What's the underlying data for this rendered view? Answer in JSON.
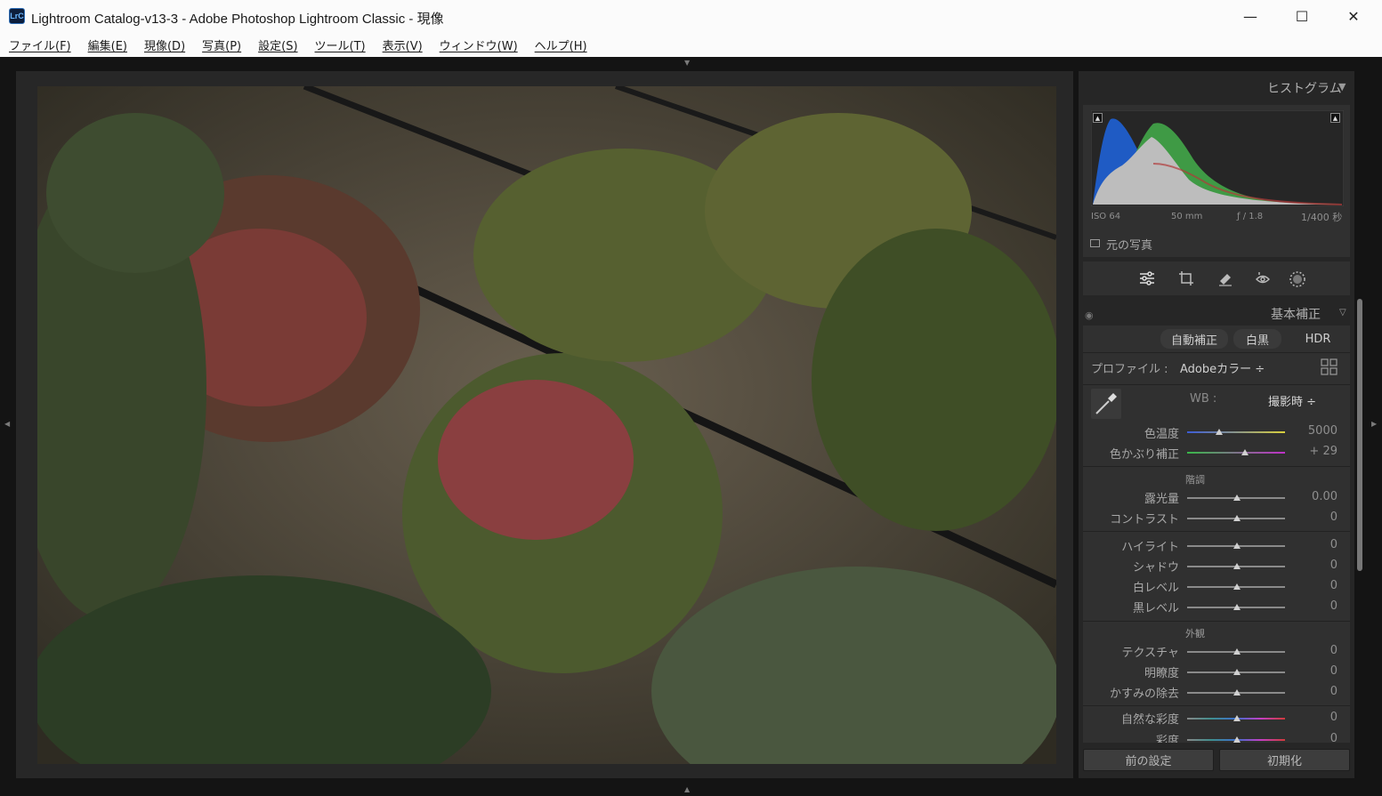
{
  "window": {
    "app_icon_text": "LrC",
    "title": "Lightroom Catalog-v13-3 - Adobe Photoshop Lightroom Classic - 現像",
    "minimize": "—",
    "maximize": "☐",
    "close": "✕"
  },
  "menu": [
    "ファイル(F)",
    "編集(E)",
    "現像(D)",
    "写真(P)",
    "設定(S)",
    "ツール(T)",
    "表示(V)",
    "ウィンドウ(W)",
    "ヘルプ(H)"
  ],
  "histogram": {
    "title": "ヒストグラム",
    "iso": "ISO 64",
    "focal": "50 mm",
    "aperture": "ƒ / 1.8",
    "shutter": "1/400 秒",
    "original_photo": "元の写真"
  },
  "tools": [
    "sliders",
    "crop",
    "eraser",
    "redeye",
    "mask"
  ],
  "basic": {
    "title": "基本補正",
    "auto": "自動補正",
    "bw": "白黒",
    "hdr": "HDR",
    "profile_label": "プロファイル :",
    "profile_value": "Adobeカラー ÷",
    "wb_label": "WB :",
    "wb_value": "撮影時 ÷",
    "temp_label": "色温度",
    "temp_value": "5000",
    "tint_label": "色かぶり補正",
    "tint_value": "+ 29",
    "tone_group": "階調",
    "exposure_label": "露光量",
    "exposure_value": "0.00",
    "contrast_label": "コントラスト",
    "contrast_value": "0",
    "highlights_label": "ハイライト",
    "highlights_value": "0",
    "shadows_label": "シャドウ",
    "shadows_value": "0",
    "whites_label": "白レベル",
    "whites_value": "0",
    "blacks_label": "黒レベル",
    "blacks_value": "0",
    "presence_group": "外観",
    "texture_label": "テクスチャ",
    "texture_value": "0",
    "clarity_label": "明瞭度",
    "clarity_value": "0",
    "dehaze_label": "かすみの除去",
    "dehaze_value": "0",
    "vibrance_label": "自然な彩度",
    "vibrance_value": "0",
    "saturation_label": "彩度",
    "saturation_value": "0"
  },
  "bottom": {
    "previous": "前の設定",
    "reset": "初期化"
  },
  "colors": {
    "panel_bg": "#303030",
    "text": "#a8a8a8",
    "hist_blue": "#1f5bc4",
    "hist_green": "#3f9a45",
    "hist_gray": "#bdbdbd"
  }
}
